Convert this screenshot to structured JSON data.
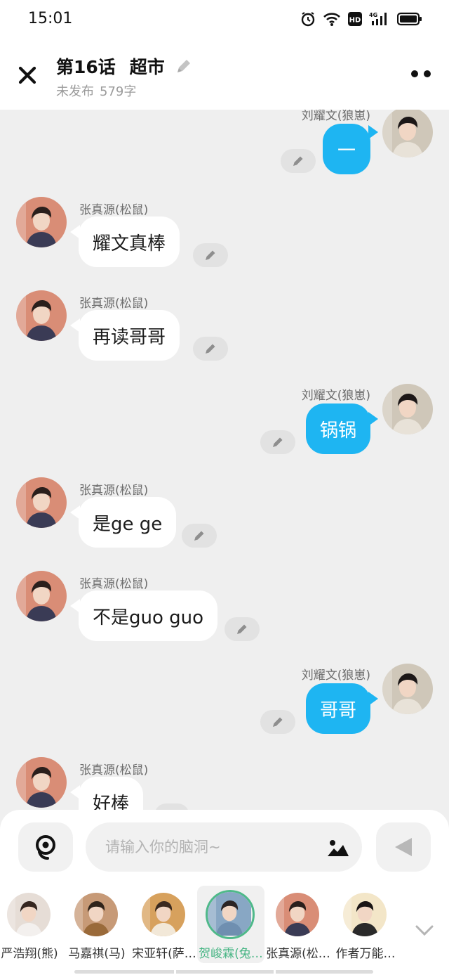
{
  "status": {
    "time": "15:01",
    "network": "4G",
    "hd": "HD"
  },
  "header": {
    "chapter": "第16话",
    "title": "超市",
    "state": "未发布",
    "word_count": "579字"
  },
  "messages": [
    {
      "side": "right",
      "name": "刘耀文(狼崽)",
      "text": "一"
    },
    {
      "side": "left",
      "name": "张真源(松鼠)",
      "text": "耀文真棒"
    },
    {
      "side": "left",
      "name": "张真源(松鼠)",
      "text": "再读哥哥"
    },
    {
      "side": "right",
      "name": "刘耀文(狼崽)",
      "text": "锅锅"
    },
    {
      "side": "left",
      "name": "张真源(松鼠)",
      "text": "是ge ge"
    },
    {
      "side": "left",
      "name": "张真源(松鼠)",
      "text": "不是guo guo"
    },
    {
      "side": "right",
      "name": "刘耀文(狼崽)",
      "text": "哥哥"
    },
    {
      "side": "left",
      "name": "张真源(松鼠)",
      "text": "好棒"
    }
  ],
  "composer": {
    "placeholder": "请输入你的脑洞~"
  },
  "roles": [
    {
      "label": "严浩翔(熊)",
      "active": false
    },
    {
      "label": "马嘉祺(马)",
      "active": false
    },
    {
      "label": "宋亚轩(萨…",
      "active": false
    },
    {
      "label": "贺峻霖(兔…",
      "active": true
    },
    {
      "label": "张真源(松…",
      "active": false
    },
    {
      "label": "作者万能…",
      "active": false
    }
  ],
  "colors": {
    "accent_blue": "#1eb5f2",
    "active_green": "#47b584"
  }
}
